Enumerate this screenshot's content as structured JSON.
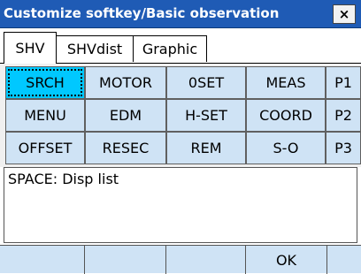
{
  "window": {
    "title": "Customize softkey/Basic observation",
    "close_label": "×"
  },
  "tabs": [
    {
      "label": "SHV",
      "active": true
    },
    {
      "label": "SHVdist",
      "active": false
    },
    {
      "label": "Graphic",
      "active": false
    }
  ],
  "keys": {
    "row1": [
      "SRCH",
      "MOTOR",
      "0SET",
      "MEAS",
      "P1"
    ],
    "row2": [
      "MENU",
      "EDM",
      "H-SET",
      "COORD",
      "P2"
    ],
    "row3": [
      "OFFSET",
      "RESEC",
      "REM",
      "S-O",
      "P3"
    ]
  },
  "selected_key": "SRCH",
  "info": {
    "text": "SPACE: Disp list"
  },
  "function_keys": [
    "",
    "",
    "",
    "OK",
    ""
  ],
  "colors": {
    "titlebar": "#1f5bb5",
    "key_background": "#cfe3f5",
    "selected_key": "#00c8ff"
  }
}
